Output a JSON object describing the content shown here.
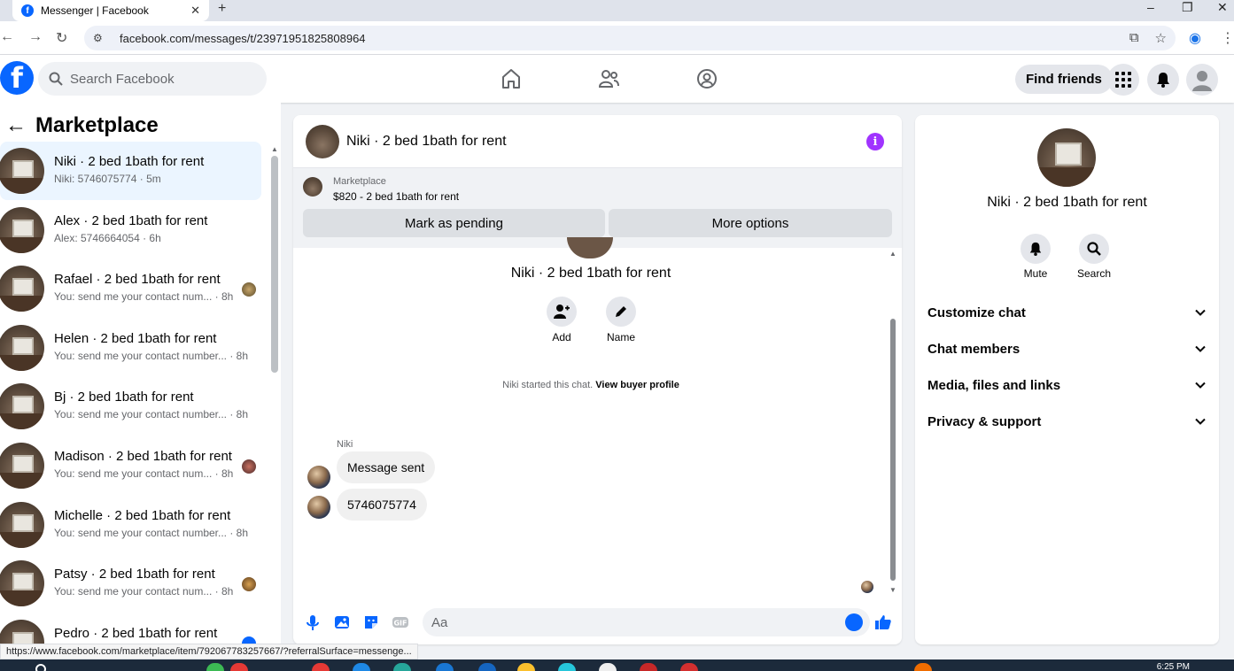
{
  "browser": {
    "tab_title": "Messenger | Facebook",
    "url": "facebook.com/messages/t/23971951825808964",
    "status_url": "https://www.facebook.com/marketplace/item/792067783257667/?referralSurface=messenge..."
  },
  "fbnav": {
    "logo_letter": "f",
    "search_placeholder": "Search Facebook",
    "find_friends": "Find friends"
  },
  "left": {
    "title": "Marketplace",
    "conversations": [
      {
        "name": "Niki · 2 bed 1bath for rent",
        "sub": "Niki: 5746075774 · 5m",
        "selected": true
      },
      {
        "name": "Alex · 2 bed 1bath for rent",
        "sub": "Alex: 5746664054 · 6h"
      },
      {
        "name": "Rafael · 2 bed 1bath for rent",
        "sub": "You: send me your contact num... · 8h"
      },
      {
        "name": "Helen · 2 bed 1bath for rent",
        "sub": "You: send me your contact number... · 8h"
      },
      {
        "name": "Bj · 2 bed 1bath for rent",
        "sub": "You: send me your contact number... · 8h"
      },
      {
        "name": "Madison · 2 bed 1bath for rent",
        "sub": "You: send me your contact num... · 8h"
      },
      {
        "name": "Michelle · 2 bed 1bath for rent",
        "sub": "You: send me your contact number... · 8h"
      },
      {
        "name": "Patsy · 2 bed 1bath for rent",
        "sub": "You: send me your contact num... · 8h"
      },
      {
        "name": "Pedro · 2 bed 1bath for rent",
        "sub": ""
      }
    ]
  },
  "chat": {
    "title": "Niki · 2 bed 1bath for rent",
    "marketplace_label": "Marketplace",
    "listing": "$820 - 2 bed 1bath for rent",
    "mark_pending": "Mark as pending",
    "more_options": "More options",
    "profile_name": "Niki · 2 bed 1bath for rent",
    "add_label": "Add",
    "name_label": "Name",
    "started_text": "Niki started this chat.",
    "view_profile": "View buyer profile",
    "sender": "Niki",
    "messages": [
      "Message sent",
      "5746075774"
    ],
    "composer_placeholder": "Aa"
  },
  "right": {
    "name": "Niki · 2 bed 1bath for rent",
    "mute": "Mute",
    "search": "Search",
    "sections": [
      "Customize chat",
      "Chat members",
      "Media, files and links",
      "Privacy & support"
    ]
  },
  "taskbar": {
    "time": "6:25 PM"
  },
  "colors": {
    "fb_blue": "#0866ff",
    "selected_bg": "#ebf5ff",
    "info_purple": "#a033ff"
  }
}
